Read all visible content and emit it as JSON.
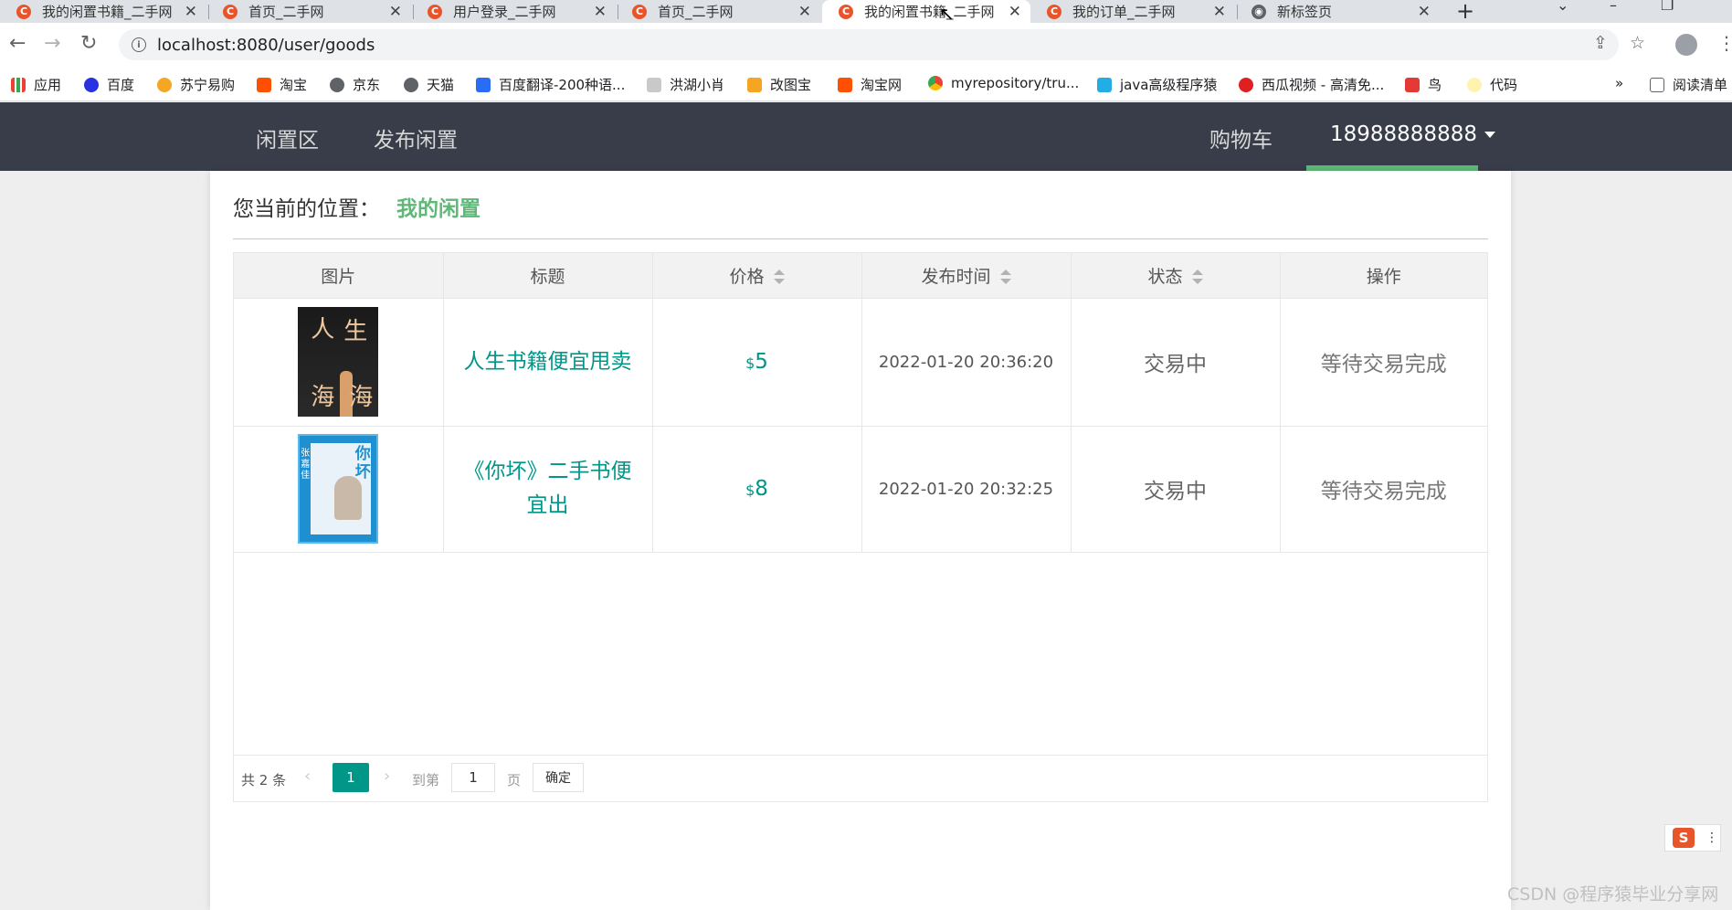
{
  "browser": {
    "tabs": [
      {
        "title": "我的闲置书籍_二手网",
        "icon": "csdn-favicon"
      },
      {
        "title": "首页_二手网",
        "icon": "csdn-favicon"
      },
      {
        "title": "用户登录_二手网",
        "icon": "csdn-favicon"
      },
      {
        "title": "首页_二手网",
        "icon": "csdn-favicon"
      },
      {
        "title": "我的闲置书籍_二手网",
        "icon": "csdn-favicon",
        "active": true
      },
      {
        "title": "我的订单_二手网",
        "icon": "csdn-favicon"
      },
      {
        "title": "新标签页",
        "icon": "chrome-favicon"
      }
    ],
    "url": "localhost:8080/user/goods",
    "bookmarks": [
      {
        "label": "应用",
        "icon": "apps-grid-icon"
      },
      {
        "label": "百度",
        "icon": "baidu-paw-icon"
      },
      {
        "label": "苏宁易购",
        "icon": "suning-icon"
      },
      {
        "label": "淘宝",
        "icon": "taobao-icon"
      },
      {
        "label": "京东",
        "icon": "globe-icon"
      },
      {
        "label": "天猫",
        "icon": "globe-icon"
      },
      {
        "label": "百度翻译-200种语...",
        "icon": "translate-icon"
      },
      {
        "label": "洪湖小肖",
        "icon": "bird-icon"
      },
      {
        "label": "改图宝",
        "icon": "gaitubao-icon"
      },
      {
        "label": "淘宝网",
        "icon": "taobao-icon"
      },
      {
        "label": "myrepository/tru...",
        "icon": "chrome-icon"
      },
      {
        "label": "java高级程序猿",
        "icon": "bilibili-icon"
      },
      {
        "label": "西瓜视频 - 高清免...",
        "icon": "xigua-icon"
      },
      {
        "label": "鸟",
        "icon": "bird-red-icon"
      },
      {
        "label": "代码",
        "icon": "bulb-icon"
      }
    ],
    "more": "»",
    "reading_list": "阅读清单"
  },
  "header": {
    "nav": [
      "闲置区",
      "发布闲置"
    ],
    "cart": "购物车",
    "user": "18988888888",
    "accent": "#5fb878",
    "bg": "#393d49"
  },
  "breadcrumb": {
    "prefix": "您当前的位置：",
    "current": "我的闲置"
  },
  "table": {
    "columns": [
      "图片",
      "标题",
      "价格",
      "发布时间",
      "状态",
      "操作"
    ],
    "sortable": [
      false,
      false,
      true,
      true,
      true,
      false
    ],
    "rows": [
      {
        "image": "人生海海 book cover",
        "title": "人生书籍便宜甩卖",
        "currency": "$",
        "price": "5",
        "time": "2022-01-20 20:36:20",
        "status": "交易中",
        "action": "等待交易完成"
      },
      {
        "image": "你坏 book cover",
        "title": "《你坏》二手书便宜出",
        "currency": "$",
        "price": "8",
        "time": "2022-01-20 20:32:25",
        "status": "交易中",
        "action": "等待交易完成"
      }
    ]
  },
  "book1": {
    "c1": "人",
    "c2": "生",
    "c3": "海",
    "c4": "海"
  },
  "book2": {
    "title": "你坏",
    "side": "张嘉佳"
  },
  "pager": {
    "total": "共 2 条",
    "current": "1",
    "goto": "到第",
    "input": "1",
    "unit": "页",
    "confirm": "确定"
  },
  "ime": "S",
  "watermark": "CSDN @程序猿毕业分享网",
  "primary_color": "#009688"
}
